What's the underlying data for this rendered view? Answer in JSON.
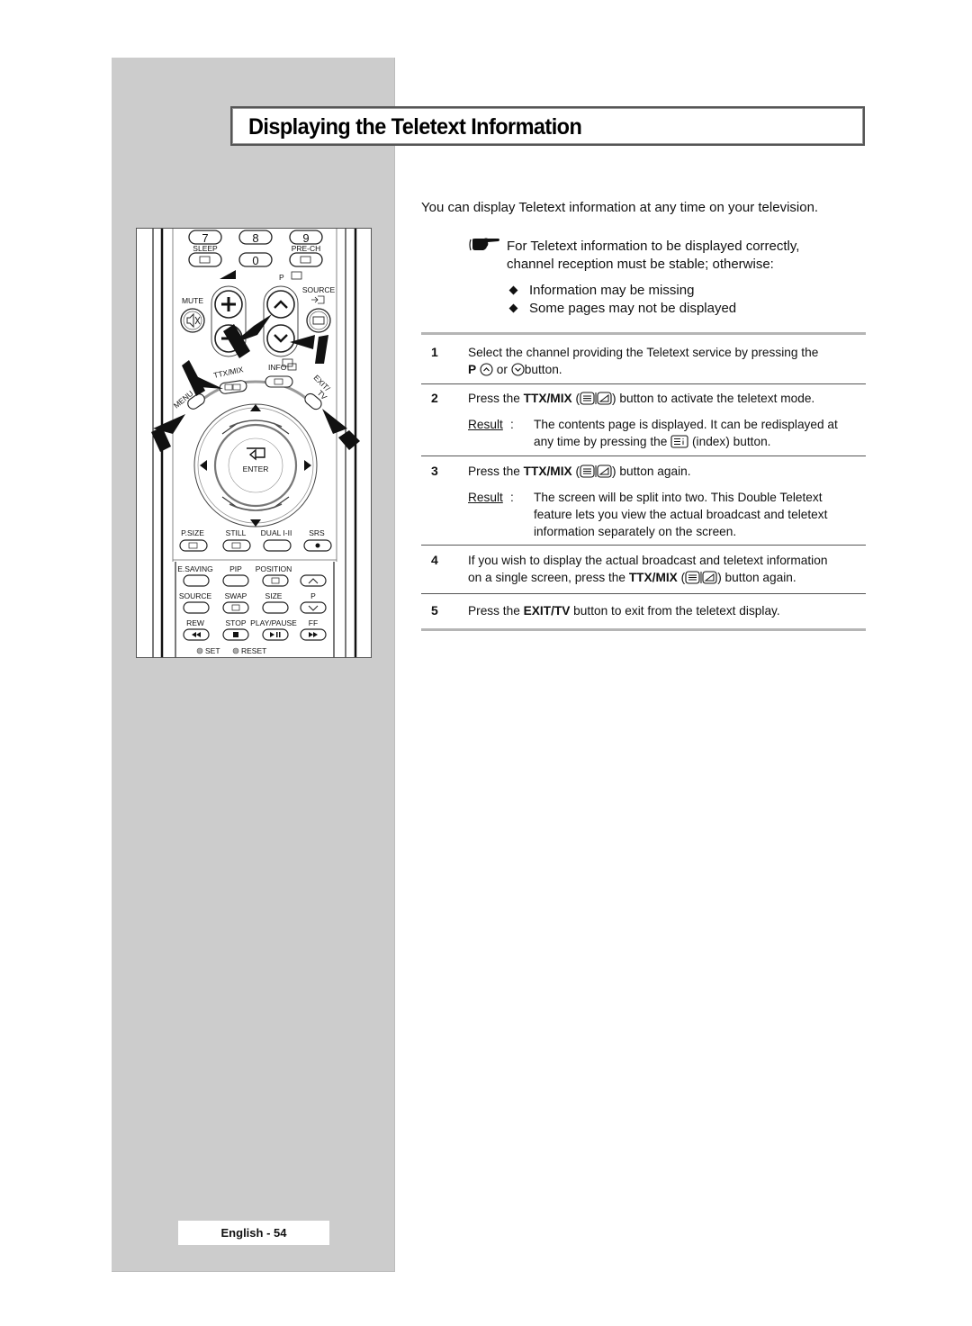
{
  "page": {
    "title": "Displaying the Teletext Information",
    "footer": "English - 54",
    "accent_panel_color": "#cccccc"
  },
  "intro": "You can display Teletext information at any time on your television.",
  "note": {
    "icon": "pointing-hand-icon",
    "line1": "For Teletext information to be displayed correctly,",
    "line2": "channel reception must be stable; otherwise:",
    "bullets": [
      "Information may be missing",
      "Some pages may not be displayed"
    ]
  },
  "steps": [
    {
      "number": "1",
      "parts": {
        "a": "Select the channel providing the Teletext service by pressing the",
        "b_bold": "P",
        "c": "or",
        "d": "button."
      }
    },
    {
      "number": "2",
      "parts": {
        "a": "Press the",
        "b_bold": "TTX/MIX",
        "c": "(",
        "d": ") button to activate the teletext mode."
      },
      "result_label": "Result",
      "result_line1": "The contents page is displayed. It can be redisplayed at",
      "result_line2a": "any time by pressing the",
      "result_line2b": "(index) button."
    },
    {
      "number": "3",
      "parts": {
        "a": "Press the",
        "b_bold": "TTX/MIX",
        "c": "(",
        "d": ") button again."
      },
      "result_label": "Result",
      "result_line1": "The screen will be split into two. This Double Teletext",
      "result_line2": "feature lets you view the actual broadcast and teletext",
      "result_line3": "information separately on the screen."
    },
    {
      "number": "4",
      "parts": {
        "a": "If you wish to display the actual broadcast and teletext information",
        "b": "on a single screen, press the",
        "c_bold": "TTX/MIX",
        "d": "(",
        "e": ") button again."
      }
    },
    {
      "number": "5",
      "parts": {
        "a": "Press the",
        "b_bold": "EXIT/TV",
        "c": "button to exit from the teletext display."
      }
    }
  ],
  "remote": {
    "num_keys": [
      "7",
      "8",
      "9",
      "0"
    ],
    "labels": {
      "sleep": "SLEEP",
      "prech": "PRE-CH",
      "p": "P",
      "mute": "MUTE",
      "source": "SOURCE",
      "ttxmix": "TTX/MIX",
      "info": "INFO",
      "menu": "MENU",
      "exit1": "EXIT/",
      "exit2": "TV",
      "enter": "ENTER",
      "psize": "P.SIZE",
      "still": "STILL",
      "dual": "DUAL I-II",
      "srs": "SRS",
      "esaving": "E.SAVING",
      "pip": "PIP",
      "position": "POSITION",
      "source2": "SOURCE",
      "swap": "SWAP",
      "size": "SIZE",
      "p2": "P",
      "rew": "REW",
      "stop": "STOP",
      "playpause": "PLAY/PAUSE",
      "ff": "FF",
      "set": "SET",
      "reset": "RESET"
    }
  }
}
